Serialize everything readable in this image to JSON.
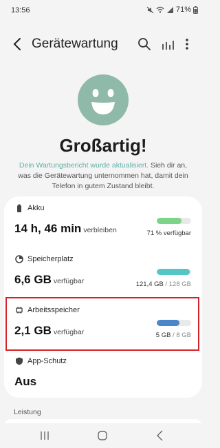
{
  "status_bar": {
    "time": "13:56",
    "battery": "71%"
  },
  "app_bar": {
    "title": "Gerätewartung"
  },
  "hero": {
    "headline": "Großartig!",
    "link_text": "Dein Wartungsbericht wurde aktualisiert.",
    "rest_text": " Sieh dir an, was die Gerätewartung unternommen hat, damit dein Telefon in gutem Zustand bleibt."
  },
  "items": [
    {
      "label": "Akku",
      "value": "14 h, 46 min",
      "unit": "verbleiben",
      "caption_strong": "71 % verfügbar",
      "caption_muted": "",
      "fill": 0.71,
      "color": "#7ed38a"
    },
    {
      "label": "Speicherplatz",
      "value": "6,6 GB",
      "unit": "verfügbar",
      "caption_strong": "121,4 GB",
      "caption_muted": " / 128 GB",
      "fill": 0.95,
      "color": "#55c6c4"
    },
    {
      "label": "Arbeitsspeicher",
      "value": "2,1 GB",
      "unit": "verfügbar",
      "caption_strong": "5 GB",
      "caption_muted": " / 8 GB",
      "fill": 0.65,
      "color": "#4a86c8"
    },
    {
      "label": "App-Schutz",
      "value": "Aus"
    }
  ],
  "section": {
    "label": "Leistung"
  },
  "colors": {
    "accent": "#8fb9a8",
    "link": "#5fb0a6",
    "highlight": "#d6232a"
  }
}
